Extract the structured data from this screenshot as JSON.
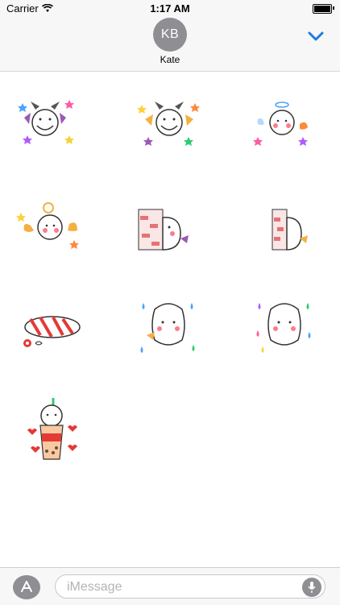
{
  "status_bar": {
    "carrier": "Carrier",
    "time": "1:17 AM"
  },
  "header": {
    "avatar_initials": "KB",
    "contact_name": "Kate",
    "accent_color": "#1f7ae0"
  },
  "stickers": [
    {
      "name": "devil-sheep-grin"
    },
    {
      "name": "devil-sheep-stars"
    },
    {
      "name": "angel-sheep-halo"
    },
    {
      "name": "angel-sheep-wings"
    },
    {
      "name": "sheep-peek-brick-wall"
    },
    {
      "name": "sheep-hide-brick-wall"
    },
    {
      "name": "sheep-lying-ribbon"
    },
    {
      "name": "sheep-worried-sweat"
    },
    {
      "name": "sheep-worried-colorful"
    },
    {
      "name": "sheep-bubble-tea-hearts"
    }
  ],
  "input": {
    "placeholder": "iMessage"
  }
}
